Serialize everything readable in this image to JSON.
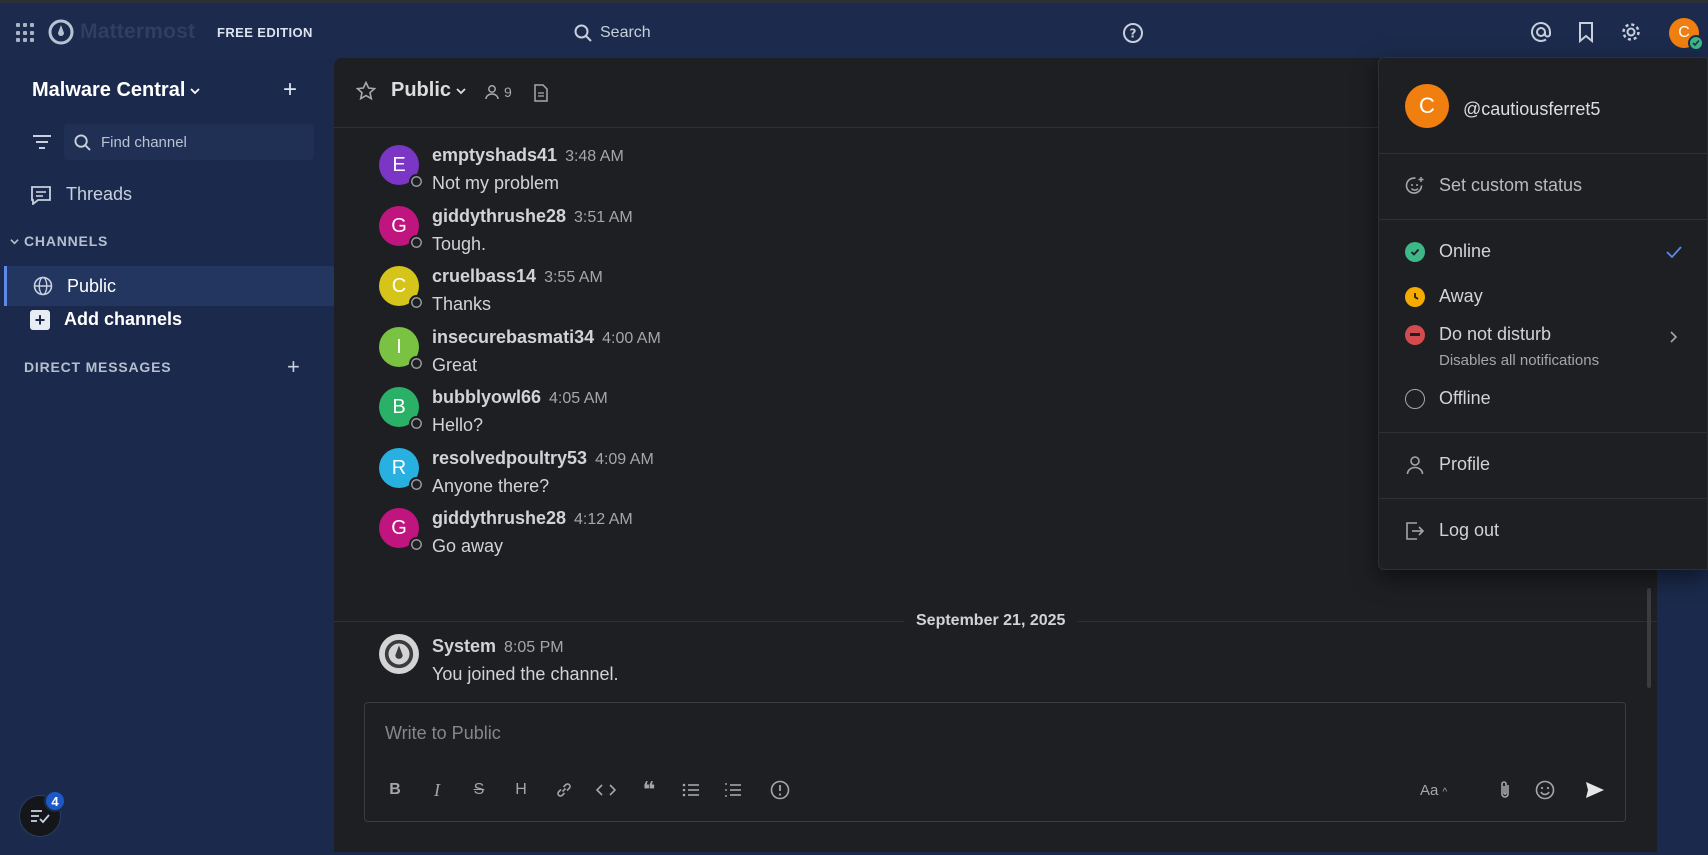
{
  "topbar": {
    "logo_text": "Mattermost",
    "edition": "FREE EDITION",
    "search_label": "Search",
    "avatar_initial": "C"
  },
  "sidebar": {
    "team_name": "Malware Central",
    "find_channel_placeholder": "Find channel",
    "threads_label": "Threads",
    "channels_header": "CHANNELS",
    "channels": [
      {
        "label": "Public"
      }
    ],
    "add_channels_label": "Add channels",
    "dm_header": "DIRECT MESSAGES",
    "threads_badge_count": "4"
  },
  "channel": {
    "name": "Public",
    "member_count": "9"
  },
  "messages": [
    {
      "initial": "E",
      "color": "#7b36c5",
      "user": "emptyshads41",
      "time": "3:48 AM",
      "text": "Not my problem"
    },
    {
      "initial": "G",
      "color": "#c0147f",
      "user": "giddythrushe28",
      "time": "3:51 AM",
      "text": "Tough."
    },
    {
      "initial": "C",
      "color": "#d5c51a",
      "user": "cruelbass14",
      "time": "3:55 AM",
      "text": "Thanks"
    },
    {
      "initial": "I",
      "color": "#79c242",
      "user": "insecurebasmati34",
      "time": "4:00 AM",
      "text": "Great"
    },
    {
      "initial": "B",
      "color": "#2bb068",
      "user": "bubblyowl66",
      "time": "4:05 AM",
      "text": "Hello?"
    },
    {
      "initial": "R",
      "color": "#27b0e0",
      "user": "resolvedpoultry53",
      "time": "4:09 AM",
      "text": "Anyone there?"
    },
    {
      "initial": "G",
      "color": "#c0147f",
      "user": "giddythrushe28",
      "time": "4:12 AM",
      "text": "Go away"
    }
  ],
  "date_separator": "September 21, 2025",
  "system_message": {
    "user": "System",
    "time": "8:05 PM",
    "text": "You joined the channel."
  },
  "composer": {
    "placeholder": "Write to Public",
    "aa_label": "Aa"
  },
  "status_menu": {
    "avatar_initial": "C",
    "handle": "@cautiousferret5",
    "set_custom_status": "Set custom status",
    "online": "Online",
    "away": "Away",
    "dnd": "Do not disturb",
    "dnd_sub": "Disables all notifications",
    "offline": "Offline",
    "profile": "Profile",
    "logout": "Log out"
  },
  "colors": {
    "sidebar_bg": "#1b2a4c",
    "main_bg": "#1e1f22",
    "online": "#3db887",
    "away": "#f5ab00",
    "dnd": "#d24b4e",
    "avatar_orange": "#f07f0f"
  }
}
